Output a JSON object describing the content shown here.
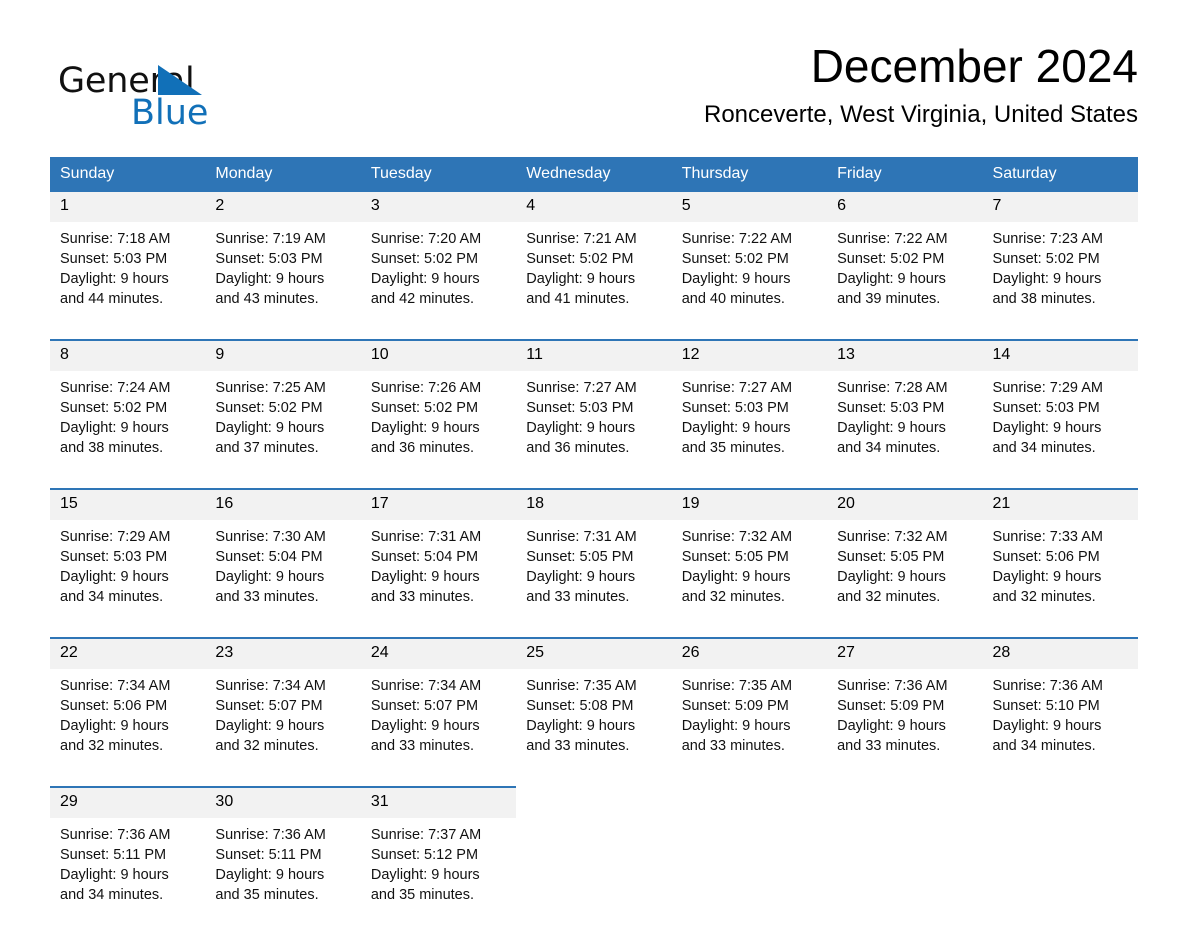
{
  "logo": {
    "text_primary": "General",
    "text_secondary": "Blue",
    "primary_color": "#111111",
    "secondary_color": "#1170b8"
  },
  "header": {
    "title": "December 2024",
    "subtitle": "Ronceverte, West Virginia, United States"
  },
  "theme": {
    "header_blue": "#2e75b6",
    "daynum_bg": "#f2f2f2",
    "row_divider": "#2e75b6"
  },
  "calendar": {
    "weekday_headers": [
      "Sunday",
      "Monday",
      "Tuesday",
      "Wednesday",
      "Thursday",
      "Friday",
      "Saturday"
    ],
    "weeks": [
      [
        {
          "day": "1",
          "sunrise": "Sunrise: 7:18 AM",
          "sunset": "Sunset: 5:03 PM",
          "daylight_1": "Daylight: 9 hours",
          "daylight_2": "and 44 minutes."
        },
        {
          "day": "2",
          "sunrise": "Sunrise: 7:19 AM",
          "sunset": "Sunset: 5:03 PM",
          "daylight_1": "Daylight: 9 hours",
          "daylight_2": "and 43 minutes."
        },
        {
          "day": "3",
          "sunrise": "Sunrise: 7:20 AM",
          "sunset": "Sunset: 5:02 PM",
          "daylight_1": "Daylight: 9 hours",
          "daylight_2": "and 42 minutes."
        },
        {
          "day": "4",
          "sunrise": "Sunrise: 7:21 AM",
          "sunset": "Sunset: 5:02 PM",
          "daylight_1": "Daylight: 9 hours",
          "daylight_2": "and 41 minutes."
        },
        {
          "day": "5",
          "sunrise": "Sunrise: 7:22 AM",
          "sunset": "Sunset: 5:02 PM",
          "daylight_1": "Daylight: 9 hours",
          "daylight_2": "and 40 minutes."
        },
        {
          "day": "6",
          "sunrise": "Sunrise: 7:22 AM",
          "sunset": "Sunset: 5:02 PM",
          "daylight_1": "Daylight: 9 hours",
          "daylight_2": "and 39 minutes."
        },
        {
          "day": "7",
          "sunrise": "Sunrise: 7:23 AM",
          "sunset": "Sunset: 5:02 PM",
          "daylight_1": "Daylight: 9 hours",
          "daylight_2": "and 38 minutes."
        }
      ],
      [
        {
          "day": "8",
          "sunrise": "Sunrise: 7:24 AM",
          "sunset": "Sunset: 5:02 PM",
          "daylight_1": "Daylight: 9 hours",
          "daylight_2": "and 38 minutes."
        },
        {
          "day": "9",
          "sunrise": "Sunrise: 7:25 AM",
          "sunset": "Sunset: 5:02 PM",
          "daylight_1": "Daylight: 9 hours",
          "daylight_2": "and 37 minutes."
        },
        {
          "day": "10",
          "sunrise": "Sunrise: 7:26 AM",
          "sunset": "Sunset: 5:02 PM",
          "daylight_1": "Daylight: 9 hours",
          "daylight_2": "and 36 minutes."
        },
        {
          "day": "11",
          "sunrise": "Sunrise: 7:27 AM",
          "sunset": "Sunset: 5:03 PM",
          "daylight_1": "Daylight: 9 hours",
          "daylight_2": "and 36 minutes."
        },
        {
          "day": "12",
          "sunrise": "Sunrise: 7:27 AM",
          "sunset": "Sunset: 5:03 PM",
          "daylight_1": "Daylight: 9 hours",
          "daylight_2": "and 35 minutes."
        },
        {
          "day": "13",
          "sunrise": "Sunrise: 7:28 AM",
          "sunset": "Sunset: 5:03 PM",
          "daylight_1": "Daylight: 9 hours",
          "daylight_2": "and 34 minutes."
        },
        {
          "day": "14",
          "sunrise": "Sunrise: 7:29 AM",
          "sunset": "Sunset: 5:03 PM",
          "daylight_1": "Daylight: 9 hours",
          "daylight_2": "and 34 minutes."
        }
      ],
      [
        {
          "day": "15",
          "sunrise": "Sunrise: 7:29 AM",
          "sunset": "Sunset: 5:03 PM",
          "daylight_1": "Daylight: 9 hours",
          "daylight_2": "and 34 minutes."
        },
        {
          "day": "16",
          "sunrise": "Sunrise: 7:30 AM",
          "sunset": "Sunset: 5:04 PM",
          "daylight_1": "Daylight: 9 hours",
          "daylight_2": "and 33 minutes."
        },
        {
          "day": "17",
          "sunrise": "Sunrise: 7:31 AM",
          "sunset": "Sunset: 5:04 PM",
          "daylight_1": "Daylight: 9 hours",
          "daylight_2": "and 33 minutes."
        },
        {
          "day": "18",
          "sunrise": "Sunrise: 7:31 AM",
          "sunset": "Sunset: 5:05 PM",
          "daylight_1": "Daylight: 9 hours",
          "daylight_2": "and 33 minutes."
        },
        {
          "day": "19",
          "sunrise": "Sunrise: 7:32 AM",
          "sunset": "Sunset: 5:05 PM",
          "daylight_1": "Daylight: 9 hours",
          "daylight_2": "and 32 minutes."
        },
        {
          "day": "20",
          "sunrise": "Sunrise: 7:32 AM",
          "sunset": "Sunset: 5:05 PM",
          "daylight_1": "Daylight: 9 hours",
          "daylight_2": "and 32 minutes."
        },
        {
          "day": "21",
          "sunrise": "Sunrise: 7:33 AM",
          "sunset": "Sunset: 5:06 PM",
          "daylight_1": "Daylight: 9 hours",
          "daylight_2": "and 32 minutes."
        }
      ],
      [
        {
          "day": "22",
          "sunrise": "Sunrise: 7:34 AM",
          "sunset": "Sunset: 5:06 PM",
          "daylight_1": "Daylight: 9 hours",
          "daylight_2": "and 32 minutes."
        },
        {
          "day": "23",
          "sunrise": "Sunrise: 7:34 AM",
          "sunset": "Sunset: 5:07 PM",
          "daylight_1": "Daylight: 9 hours",
          "daylight_2": "and 32 minutes."
        },
        {
          "day": "24",
          "sunrise": "Sunrise: 7:34 AM",
          "sunset": "Sunset: 5:07 PM",
          "daylight_1": "Daylight: 9 hours",
          "daylight_2": "and 33 minutes."
        },
        {
          "day": "25",
          "sunrise": "Sunrise: 7:35 AM",
          "sunset": "Sunset: 5:08 PM",
          "daylight_1": "Daylight: 9 hours",
          "daylight_2": "and 33 minutes."
        },
        {
          "day": "26",
          "sunrise": "Sunrise: 7:35 AM",
          "sunset": "Sunset: 5:09 PM",
          "daylight_1": "Daylight: 9 hours",
          "daylight_2": "and 33 minutes."
        },
        {
          "day": "27",
          "sunrise": "Sunrise: 7:36 AM",
          "sunset": "Sunset: 5:09 PM",
          "daylight_1": "Daylight: 9 hours",
          "daylight_2": "and 33 minutes."
        },
        {
          "day": "28",
          "sunrise": "Sunrise: 7:36 AM",
          "sunset": "Sunset: 5:10 PM",
          "daylight_1": "Daylight: 9 hours",
          "daylight_2": "and 34 minutes."
        }
      ],
      [
        {
          "day": "29",
          "sunrise": "Sunrise: 7:36 AM",
          "sunset": "Sunset: 5:11 PM",
          "daylight_1": "Daylight: 9 hours",
          "daylight_2": "and 34 minutes."
        },
        {
          "day": "30",
          "sunrise": "Sunrise: 7:36 AM",
          "sunset": "Sunset: 5:11 PM",
          "daylight_1": "Daylight: 9 hours",
          "daylight_2": "and 35 minutes."
        },
        {
          "day": "31",
          "sunrise": "Sunrise: 7:37 AM",
          "sunset": "Sunset: 5:12 PM",
          "daylight_1": "Daylight: 9 hours",
          "daylight_2": "and 35 minutes."
        },
        {
          "day": "",
          "sunrise": "",
          "sunset": "",
          "daylight_1": "",
          "daylight_2": ""
        },
        {
          "day": "",
          "sunrise": "",
          "sunset": "",
          "daylight_1": "",
          "daylight_2": ""
        },
        {
          "day": "",
          "sunrise": "",
          "sunset": "",
          "daylight_1": "",
          "daylight_2": ""
        },
        {
          "day": "",
          "sunrise": "",
          "sunset": "",
          "daylight_1": "",
          "daylight_2": ""
        }
      ]
    ]
  }
}
